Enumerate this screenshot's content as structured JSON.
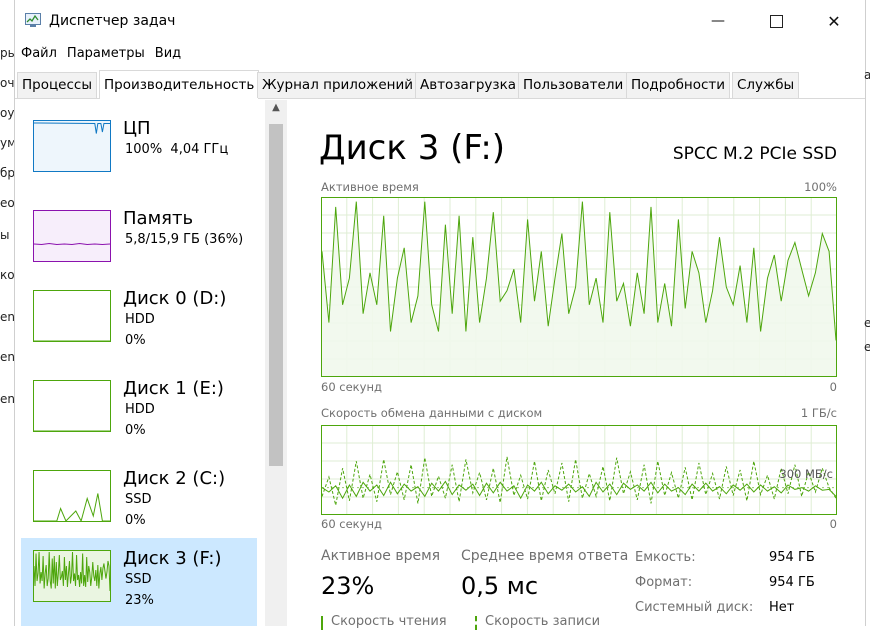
{
  "window": {
    "title": "Диспетчер задач",
    "icon": "task-manager-icon",
    "min_glyph": "—",
    "max_glyph": "☐",
    "close_glyph": "✕"
  },
  "menu": [
    "Файл",
    "Параметры",
    "Вид"
  ],
  "tabs": [
    {
      "label": "Процессы",
      "active": false
    },
    {
      "label": "Производительность",
      "active": true
    },
    {
      "label": "Журнал приложений",
      "active": false
    },
    {
      "label": "Автозагрузка",
      "active": false
    },
    {
      "label": "Пользователи",
      "active": false
    },
    {
      "label": "Подробности",
      "active": false
    },
    {
      "label": "Службы",
      "active": false
    }
  ],
  "sidebar": [
    {
      "title": "ЦП",
      "line1": "100%  4,04 ГГц",
      "line2": "",
      "color": "#1179c4",
      "selected": false
    },
    {
      "title": "Память",
      "line1": "5,8/15,9 ГБ (36%)",
      "line2": "",
      "color": "#8b12ae",
      "selected": false
    },
    {
      "title": "Диск 0 (D:)",
      "line1": "HDD",
      "line2": "0%",
      "color": "#4da60c",
      "selected": false
    },
    {
      "title": "Диск 1 (E:)",
      "line1": "HDD",
      "line2": "0%",
      "color": "#4da60c",
      "selected": false
    },
    {
      "title": "Диск 2 (C:)",
      "line1": "SSD",
      "line2": "0%",
      "color": "#4da60c",
      "selected": false
    },
    {
      "title": "Диск 3 (F:)",
      "line1": "SSD",
      "line2": "23%",
      "color": "#4da60c",
      "selected": true
    }
  ],
  "main": {
    "title": "Диск 3 (F:)",
    "model": "SPCC M.2 PCIe SSD",
    "chart1": {
      "label": "Активное время",
      "max": "100%",
      "time": "60 секунд",
      "zero": "0"
    },
    "chart2": {
      "label": "Скорость обмена данными с диском",
      "max": "1 ГБ/с",
      "mid": "300 МБ/с",
      "time": "60 секунд",
      "zero": "0"
    },
    "stats": {
      "active_label": "Активное время",
      "active_value": "23%",
      "resp_label": "Среднее время ответа",
      "resp_value": "0,5 мс",
      "cap_key": "Емкость:",
      "cap_val": "954 ГБ",
      "fmt_key": "Формат:",
      "fmt_val": "954 ГБ",
      "sys_key": "Системный диск:",
      "sys_val": "Нет",
      "read_label": "Скорость чтения",
      "write_label": "Скорость записи"
    }
  },
  "edge_left": [
    "ры",
    "оч",
    "оу",
    "ум",
    "бр",
    "ео",
    "ы",
    "ко",
    "ent",
    "ent",
    "ent"
  ],
  "edge_right": [
    "а",
    "е",
    "е"
  ],
  "colors": {
    "disk_line": "#4da60c",
    "disk_fill": "#f1f8ec",
    "disk_border": "#4da60c",
    "grid": "#dfeed4",
    "selected_bg": "#cce8ff"
  },
  "chart_data": [
    {
      "type": "area",
      "title": "Активное время",
      "ylim": [
        0,
        100
      ],
      "xlabel": "60 секунд",
      "values": [
        70,
        30,
        95,
        40,
        55,
        98,
        35,
        58,
        40,
        90,
        25,
        55,
        72,
        30,
        45,
        98,
        40,
        25,
        85,
        35,
        90,
        25,
        78,
        30,
        55,
        92,
        42,
        48,
        60,
        30,
        88,
        42,
        70,
        28,
        55,
        80,
        35,
        50,
        98,
        40,
        55,
        30,
        92,
        42,
        52,
        28,
        58,
        35,
        95,
        30,
        52,
        28,
        88,
        38,
        70,
        58,
        30,
        48,
        78,
        50,
        40,
        62,
        30,
        72,
        25,
        55,
        68,
        42,
        65,
        75,
        60,
        45,
        58,
        80,
        70,
        20
      ]
    },
    {
      "type": "line",
      "title": "Скорость обмена данными с диском",
      "ylim": [
        0,
        1000
      ],
      "xlabel": "60 секунд",
      "series": [
        {
          "values": [
            300,
            250,
            320,
            180,
            330,
            200,
            360,
            260,
            330,
            210,
            360,
            230,
            340,
            260,
            310,
            200,
            350,
            260,
            370,
            220,
            330,
            270,
            340,
            210,
            350,
            240,
            360,
            260,
            320,
            180,
            330,
            260,
            360,
            230,
            320,
            270,
            340,
            250,
            310,
            200,
            360,
            250,
            340,
            220,
            350,
            280,
            330,
            260,
            360,
            240,
            340,
            260,
            300,
            220,
            340,
            260,
            350,
            260,
            310,
            230,
            330,
            270,
            340,
            250,
            330,
            260,
            310,
            240,
            330,
            280,
            300,
            260,
            320,
            270,
            280,
            200
          ]
        },
        {
          "values": [
            200,
            420,
            100,
            520,
            150,
            600,
            180,
            450,
            140,
            620,
            220,
            480,
            160,
            560,
            120,
            640,
            200,
            430,
            180,
            560,
            140,
            620,
            240,
            470,
            160,
            520,
            130,
            650,
            210,
            440,
            170,
            600,
            150,
            500,
            230,
            580,
            140,
            620,
            180,
            460,
            200,
            540,
            150,
            640,
            230,
            480,
            160,
            560,
            120,
            600,
            210,
            470,
            180,
            530,
            160,
            580,
            220,
            460,
            170,
            540,
            210,
            500,
            150,
            600,
            220,
            440,
            170,
            520,
            230,
            560,
            200,
            480,
            250,
            520,
            300,
            180
          ]
        }
      ]
    }
  ]
}
